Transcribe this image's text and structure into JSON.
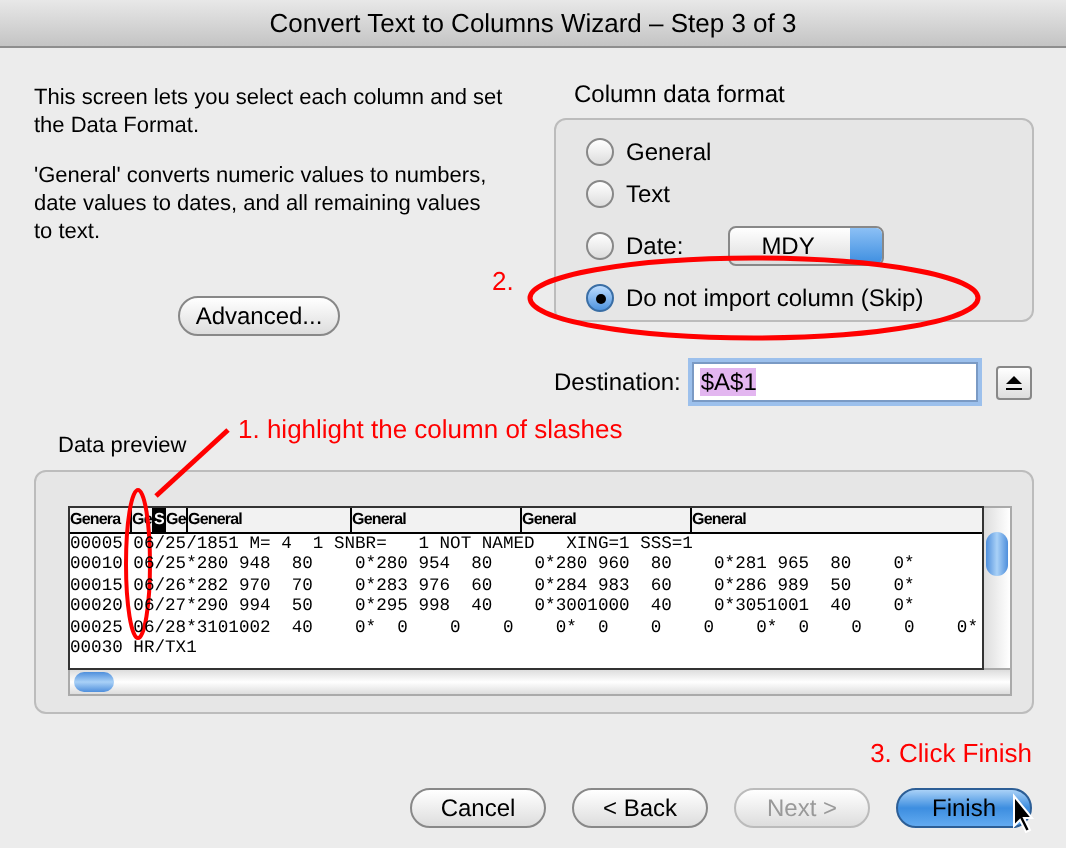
{
  "window": {
    "title": "Convert Text to Columns Wizard – Step 3 of 3"
  },
  "intro": [
    "This screen lets you select each column and set the Data Format.",
    "'General' converts numeric values to numbers, date values to dates, and all remaining values to text."
  ],
  "advanced_button": "Advanced...",
  "column_data_format": {
    "title": "Column data format",
    "options": [
      {
        "kind": "radio",
        "label": "General",
        "selected": false
      },
      {
        "kind": "radio",
        "label": "Text",
        "selected": false
      },
      {
        "kind": "date",
        "label": "Date:",
        "selected": false,
        "value": "MDY"
      },
      {
        "kind": "radio",
        "label": "Do not import column (Skip)",
        "selected": true
      }
    ]
  },
  "destination": {
    "label": "Destination:",
    "value": "$A$1"
  },
  "data_preview": {
    "title": "Data preview",
    "columns": [
      {
        "label": "Genera",
        "selected": false
      },
      {
        "label": "Ge",
        "selected": false
      },
      {
        "label": "S",
        "selected": true
      },
      {
        "label": "Ge",
        "selected": false
      },
      {
        "label": "General",
        "selected": false
      },
      {
        "label": "General",
        "selected": false
      },
      {
        "label": "General",
        "selected": false
      },
      {
        "label": "General",
        "selected": false
      }
    ],
    "rows": [
      "00005 06/25/1851 M= 4  1 SNBR=   1 NOT NAMED   XING=1 SSS=1",
      "00010 06/25*280 948  80    0*280 954  80    0*280 960  80    0*281 965  80    0*",
      "00015 06/26*282 970  70    0*283 976  60    0*284 983  60    0*286 989  50    0*",
      "00020 06/27*290 994  50    0*295 998  40    0*3001000  40    0*3051001  40    0*",
      "00025 06/28*3101002  40    0*  0    0    0    0*  0    0    0    0*  0    0    0    0*",
      "00030 HR/TX1"
    ]
  },
  "annotations": [
    "1. highlight  the column of slashes",
    "2.",
    "3. Click Finish"
  ],
  "buttons": [
    {
      "label": "Cancel",
      "kind": "normal",
      "disabled": false
    },
    {
      "label": "< Back",
      "kind": "normal",
      "disabled": false
    },
    {
      "label": "Next >",
      "kind": "normal",
      "disabled": true
    },
    {
      "label": "Finish",
      "kind": "default",
      "disabled": false
    }
  ]
}
